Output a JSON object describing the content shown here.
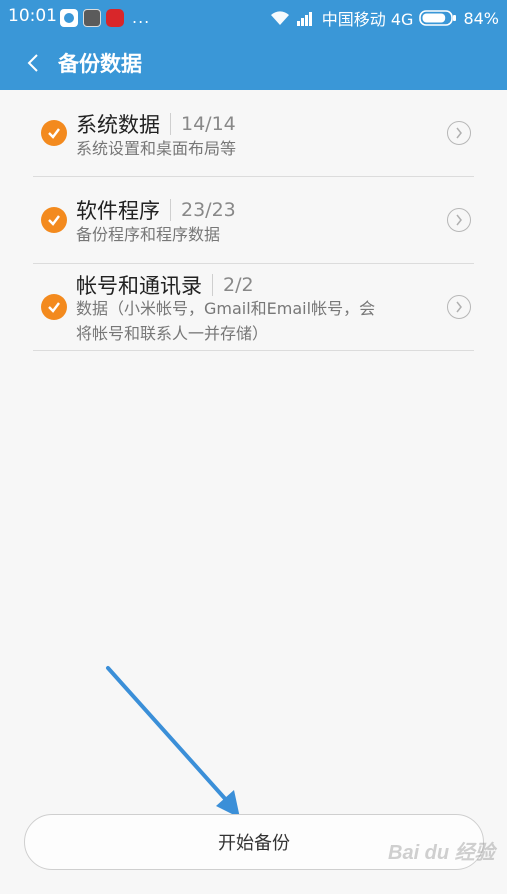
{
  "status_bar": {
    "time": "10:01",
    "dots": "...",
    "carrier": "中国移动 4G",
    "battery": "84%",
    "battery_level": 0.84
  },
  "header": {
    "title": "备份数据",
    "back_icon": "chevron-left-icon"
  },
  "items": [
    {
      "title": "系统数据",
      "count": "14/14",
      "desc": "系统设置和桌面布局等",
      "checked": true
    },
    {
      "title": "软件程序",
      "count": "23/23",
      "desc": "备份程序和程序数据",
      "checked": true
    },
    {
      "title": "帐号和通讯录",
      "count": "2/2",
      "desc": "数据（小米帐号，Gmail和Email帐号，会将帐号和联系人一并存储）",
      "checked": true
    }
  ],
  "action": {
    "start_label": "开始备份"
  },
  "watermark": "Bai du 经验",
  "colors": {
    "header_bg": "#3a97d7",
    "check": "#f38a1e",
    "annotation_arrow": "#3b8fd8"
  }
}
